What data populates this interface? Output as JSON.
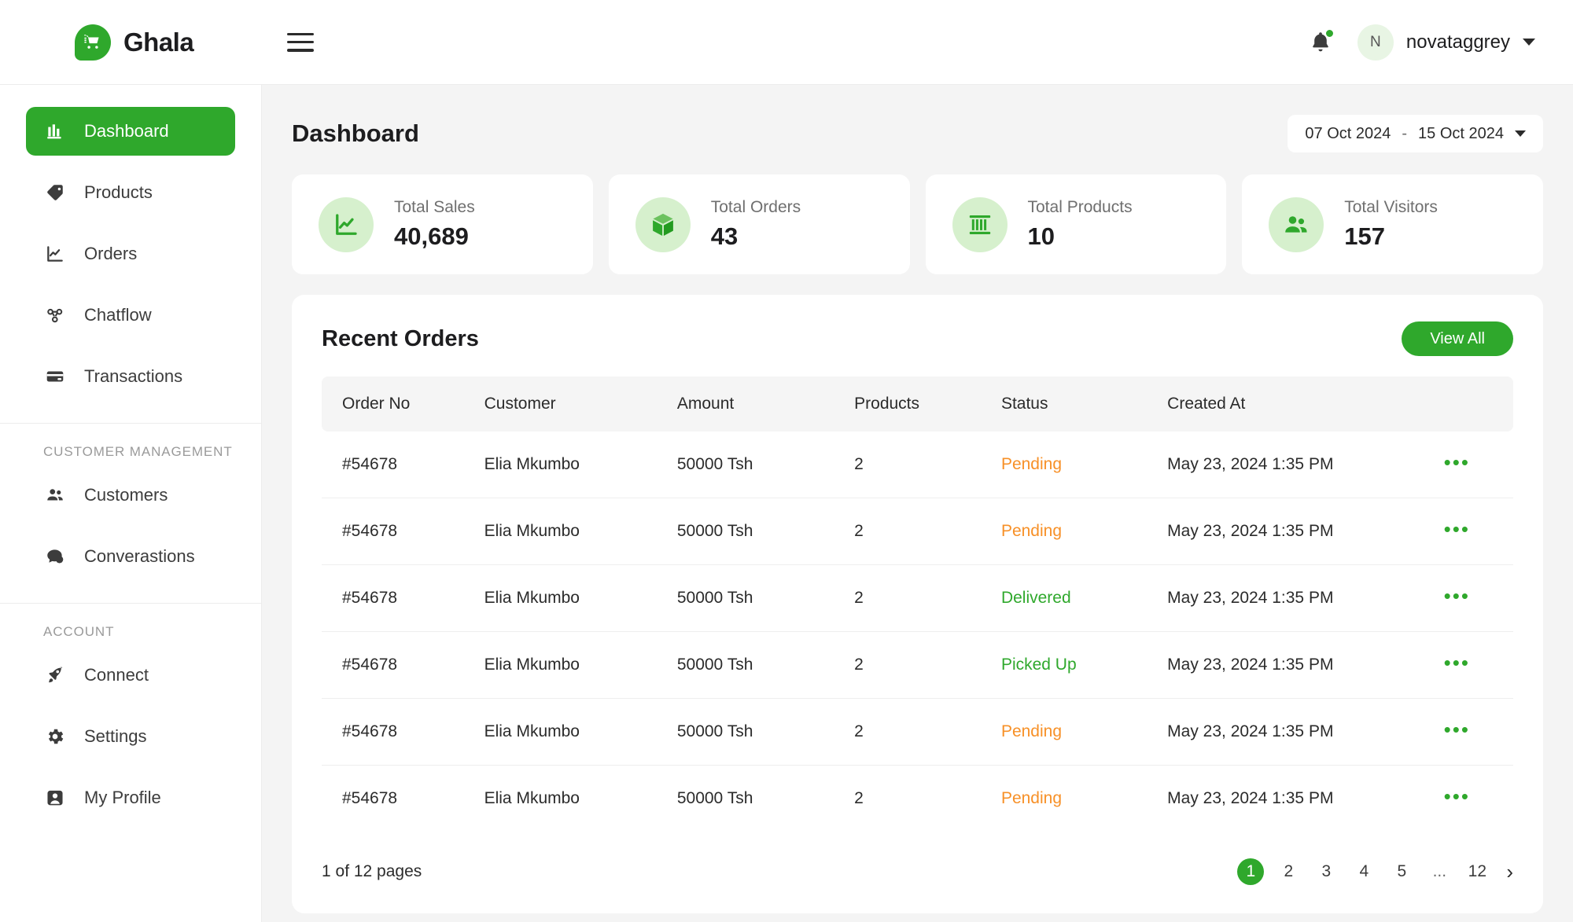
{
  "brand": {
    "name": "Ghala",
    "logo_icon": "shopping-cart-bubble-icon"
  },
  "topbar": {
    "menu_icon": "hamburger-menu-icon",
    "notifications_icon": "bell-icon",
    "user": {
      "initial": "N",
      "name": "novataggrey",
      "caret_icon": "chevron-down-icon"
    }
  },
  "sidebar": {
    "primary": [
      {
        "label": "Dashboard",
        "icon": "dashboard-chart-icon",
        "active": true
      },
      {
        "label": "Products",
        "icon": "tag-icon",
        "active": false
      },
      {
        "label": "Orders",
        "icon": "line-chart-icon",
        "active": false
      },
      {
        "label": "Chatflow",
        "icon": "flow-nodes-icon",
        "active": false
      },
      {
        "label": "Transactions",
        "icon": "credit-card-icon",
        "active": false
      }
    ],
    "group_customer": {
      "title": "CUSTOMER MANAGEMENT",
      "items": [
        {
          "label": "Customers",
          "icon": "people-icon"
        },
        {
          "label": "Converastions",
          "icon": "chat-bubbles-icon"
        }
      ]
    },
    "group_account": {
      "title": "ACCOUNT",
      "items": [
        {
          "label": "Connect",
          "icon": "rocket-icon"
        },
        {
          "label": "Settings",
          "icon": "gear-icon"
        },
        {
          "label": "My Profile",
          "icon": "user-badge-icon"
        }
      ]
    }
  },
  "main": {
    "page_title": "Dashboard",
    "date_range": {
      "start": "07 Oct 2024",
      "separator": "-",
      "end": "15 Oct 2024",
      "caret_icon": "chevron-down-icon"
    },
    "stats": [
      {
        "label": "Total Sales",
        "value": "40,689",
        "icon": "sales-chart-icon"
      },
      {
        "label": "Total Orders",
        "value": "43",
        "icon": "box-icon"
      },
      {
        "label": "Total Products",
        "value": "10",
        "icon": "barcode-icon"
      },
      {
        "label": "Total Visitors",
        "value": "157",
        "icon": "visitors-icon"
      }
    ],
    "orders": {
      "title": "Recent Orders",
      "view_all_label": "View All",
      "columns": [
        "Order No",
        "Customer",
        "Amount",
        "Products",
        "Status",
        "Created At"
      ],
      "rows": [
        {
          "order_no": "#54678",
          "customer": "Elia Mkumbo",
          "amount": "50000 Tsh",
          "products": "2",
          "status": "Pending",
          "status_kind": "pending",
          "created_at": "May 23, 2024 1:35 PM",
          "action_icon": "more-options-icon"
        },
        {
          "order_no": "#54678",
          "customer": "Elia Mkumbo",
          "amount": "50000 Tsh",
          "products": "2",
          "status": "Pending",
          "status_kind": "pending",
          "created_at": "May 23, 2024 1:35 PM",
          "action_icon": "more-options-icon"
        },
        {
          "order_no": "#54678",
          "customer": "Elia Mkumbo",
          "amount": "50000 Tsh",
          "products": "2",
          "status": "Delivered",
          "status_kind": "green",
          "created_at": "May 23, 2024 1:35 PM",
          "action_icon": "more-options-icon"
        },
        {
          "order_no": "#54678",
          "customer": "Elia Mkumbo",
          "amount": "50000 Tsh",
          "products": "2",
          "status": "Picked Up",
          "status_kind": "green",
          "created_at": "May 23, 2024 1:35 PM",
          "action_icon": "more-options-icon"
        },
        {
          "order_no": "#54678",
          "customer": "Elia Mkumbo",
          "amount": "50000 Tsh",
          "products": "2",
          "status": "Pending",
          "status_kind": "pending",
          "created_at": "May 23, 2024 1:35 PM",
          "action_icon": "more-options-icon"
        },
        {
          "order_no": "#54678",
          "customer": "Elia Mkumbo",
          "amount": "50000 Tsh",
          "products": "2",
          "status": "Pending",
          "status_kind": "pending",
          "created_at": "May 23, 2024 1:35 PM",
          "action_icon": "more-options-icon"
        }
      ],
      "pagination": {
        "info": "1 of 12 pages",
        "pages": [
          "1",
          "2",
          "3",
          "4",
          "5",
          "...",
          "12"
        ],
        "current": "1",
        "next_icon": "chevron-right-icon"
      }
    }
  },
  "colors": {
    "brand_green": "#2fa82c",
    "pending_orange": "#f79027",
    "page_bg": "#f4f4f4",
    "icon_tint": "#d6f0cd"
  }
}
